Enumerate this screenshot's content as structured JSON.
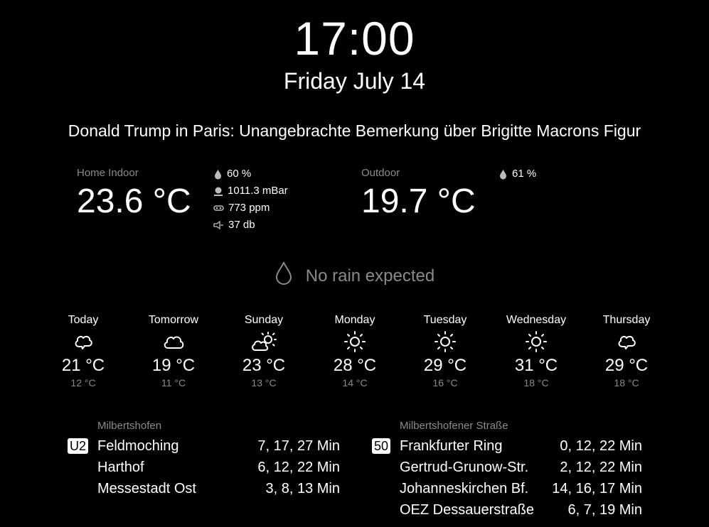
{
  "clock": {
    "time": "17:00",
    "date": "Friday July 14"
  },
  "news": {
    "headline": "Donald Trump in Paris: Unangebrachte Bemerkung über Brigitte Macrons Figur"
  },
  "indoor": {
    "label": "Home Indoor",
    "temperature": "23.6 °C",
    "humidity": "60 %",
    "pressure": "1011.3 mBar",
    "co2": "773 ppm",
    "noise": "37 db"
  },
  "outdoor": {
    "label": "Outdoor",
    "temperature": "19.7 °C",
    "humidity": "61 %"
  },
  "rain": {
    "text": "No rain expected",
    "icon": "raindrop-icon"
  },
  "forecast": [
    {
      "day": "Today",
      "icon": "cloudy-icon",
      "high": "21 °C",
      "low": "12 °C"
    },
    {
      "day": "Tomorrow",
      "icon": "cloudy-icon",
      "high": "19 °C",
      "low": "11 °C"
    },
    {
      "day": "Sunday",
      "icon": "partly-sunny-icon",
      "high": "23 °C",
      "low": "13 °C"
    },
    {
      "day": "Monday",
      "icon": "sunny-icon",
      "high": "28 °C",
      "low": "14 °C"
    },
    {
      "day": "Tuesday",
      "icon": "sunny-icon",
      "high": "29 °C",
      "low": "16 °C"
    },
    {
      "day": "Wednesday",
      "icon": "sunny-icon",
      "high": "31 °C",
      "low": "18 °C"
    },
    {
      "day": "Thursday",
      "icon": "cloudy-icon",
      "high": "29 °C",
      "low": "18 °C"
    }
  ],
  "transit": [
    {
      "station": "Milbertshofen",
      "line": "U2",
      "departures": [
        {
          "destination": "Feldmoching",
          "times": "7, 17, 27 Min"
        },
        {
          "destination": "Harthof",
          "times": "6, 12, 22 Min"
        },
        {
          "destination": "Messestadt Ost",
          "times": "3, 8, 13 Min"
        }
      ]
    },
    {
      "station": "Milbertshofener Straße",
      "line": "50",
      "departures": [
        {
          "destination": "Frankfurter Ring",
          "times": "0, 12, 22 Min"
        },
        {
          "destination": "Gertrud-Grunow-Str.",
          "times": "2, 12, 22 Min"
        },
        {
          "destination": "Johanneskirchen Bf.",
          "times": "14, 16, 17 Min"
        },
        {
          "destination": "OEZ Dessauerstraße",
          "times": "6, 7, 19 Min"
        }
      ]
    }
  ]
}
